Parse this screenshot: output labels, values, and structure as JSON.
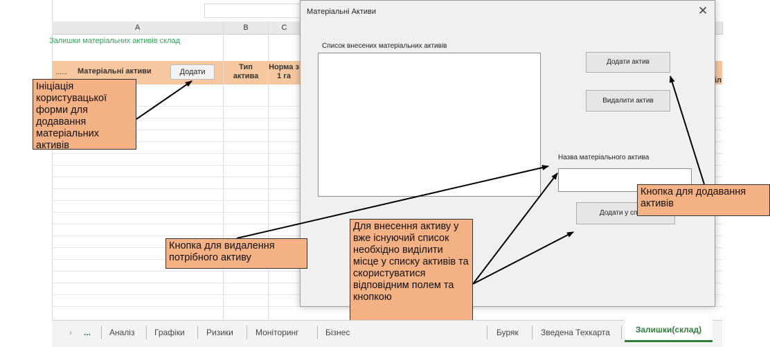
{
  "spreadsheet": {
    "column_headers": [
      "A",
      "B",
      "C"
    ],
    "sheet_title": "Залишки  матеріальних активів склад",
    "row_marker": "......",
    "header_assets": "Матеріальні активи",
    "add_button_label": "Додати",
    "header_type_line1": "Тип",
    "header_type_line2": "актива",
    "header_norm_line1": "Норма з",
    "header_norm_line2": "1 га",
    "header_right_fragment": "іл",
    "accent_color": "#f7c8a0",
    "title_color": "#37a35a"
  },
  "dialog": {
    "title": "Матеріальні Активи",
    "close_glyph": "✕",
    "list_label": "Список внесених матеріальних активів",
    "add_asset_button": "Додати актив",
    "delete_asset_button": "Видалити актив",
    "name_label": "Назва матеріального актива",
    "add_to_list_button": "Додати у список"
  },
  "callouts": {
    "init_form": "Ініціація користувацької форми для додавання матеріальних активів",
    "delete_button": "Кнопка для видалення потрібного активу",
    "insert_existing": "Для внесення активу у вже існуючий список необхідно виділити місце у списку активів та скористуватися відповідним полем та кнопкою",
    "add_button": "Кнопка для додавання активів",
    "color": "#f4b183"
  },
  "tabs": {
    "ellipsis": "...",
    "items": [
      "Аналіз",
      "Графіки",
      "Ризики",
      "Моніторинг",
      "Бізнес",
      "Буряк",
      "Зведена Техкарта"
    ],
    "active": "Залишки(склад)",
    "active_color": "#2f7d3b"
  }
}
